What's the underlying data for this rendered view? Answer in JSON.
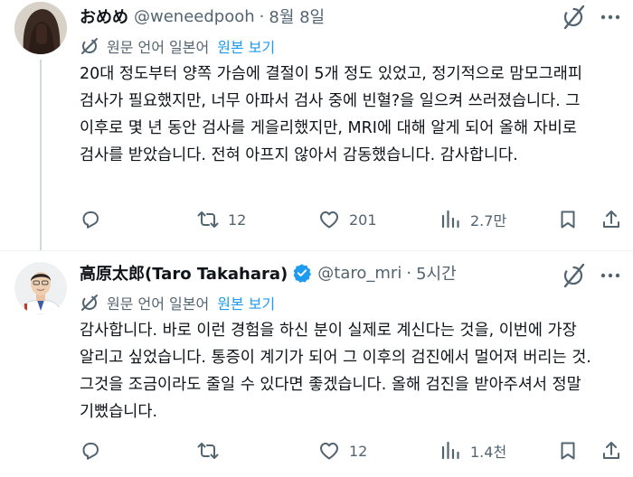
{
  "tweets": [
    {
      "display_name": "おめめ",
      "handle": "@weneedpooh",
      "separator": "·",
      "time": "8월 8일",
      "translation_label": "원문 언어 일본어",
      "show_original": "원본 보기",
      "body": "20대 정도부터 양쪽 가슴에 결절이 5개 정도 있었고, 정기적으로 맘모그래피 검사가 필요했지만, 너무 아파서 검사 중에 빈혈?을 일으켜 쓰러졌습니다. 그 이후로 몇 년 동안 검사를 게을리했지만, MRI에 대해 알게 되어 올해 자비로 검사를 받았습니다. 전혀 아프지 않아서 감동했습니다. 감사합니다.",
      "replies": "",
      "retweets": "12",
      "likes": "201",
      "views": "2.7만",
      "avatar": "dark-hair-photo",
      "verified": false
    },
    {
      "display_name": "高原太郎(Taro Takahara)",
      "handle": "@taro_mri",
      "separator": "·",
      "time": "5시간",
      "translation_label": "원문 언어 일본어",
      "show_original": "원본 보기",
      "body": "감사합니다. 바로 이런 경험을 하신 분이 실제로 계신다는 것을, 이번에 가장 알리고 싶었습니다. 통증이 계기가 되어 그 이후의 검진에서 멀어져 버리는 것. 그것을 조금이라도 줄일 수 있다면 좋겠습니다. 올해 검진을 받아주셔서 정말 기뻤습니다.",
      "replies": "",
      "retweets": "",
      "likes": "12",
      "views": "1.4천",
      "avatar": "man-in-white-coat-photo",
      "verified": true
    }
  ],
  "colors": {
    "text": "#0f1419",
    "secondary": "#536471",
    "link": "#1d9bf0",
    "verified": "#1d9bf0",
    "divider": "#eff3f4",
    "thread_line": "#cfd9de"
  },
  "icons": [
    "grok-icon",
    "more-icon",
    "translate-icon",
    "reply-icon",
    "retweet-icon",
    "like-icon",
    "views-icon",
    "bookmark-icon",
    "share-icon",
    "verified-badge-icon"
  ]
}
